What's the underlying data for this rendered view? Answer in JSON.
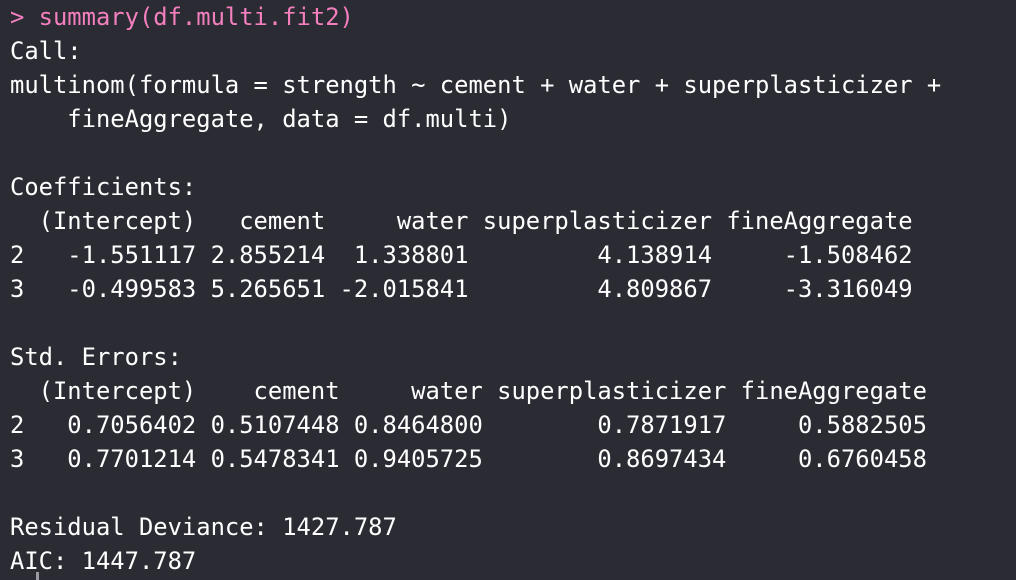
{
  "console": {
    "prompt": "> ",
    "command": "summary(df.multi.fit2)",
    "lines": [
      "Call:",
      "multinom(formula = strength ~ cement + water + superplasticizer +",
      "    fineAggregate, data = df.multi)",
      "",
      "Coefficients:",
      "  (Intercept)   cement     water superplasticizer fineAggregate",
      "2   -1.551117 2.855214  1.338801         4.138914     -1.508462",
      "3   -0.499583 5.265651 -2.015841         4.809867     -3.316049",
      "",
      "Std. Errors:",
      "  (Intercept)    cement     water superplasticizer fineAggregate",
      "2   0.7056402 0.5107448 0.8464800        0.7871917     0.5882505",
      "3   0.7701214 0.5478341 0.9405725        0.8697434     0.6760458",
      "",
      "Residual Deviance: 1427.787",
      "AIC: 1447.787"
    ]
  },
  "colors": {
    "background": "#2b2c33",
    "command": "#f37fbf",
    "output": "#ffffff"
  }
}
